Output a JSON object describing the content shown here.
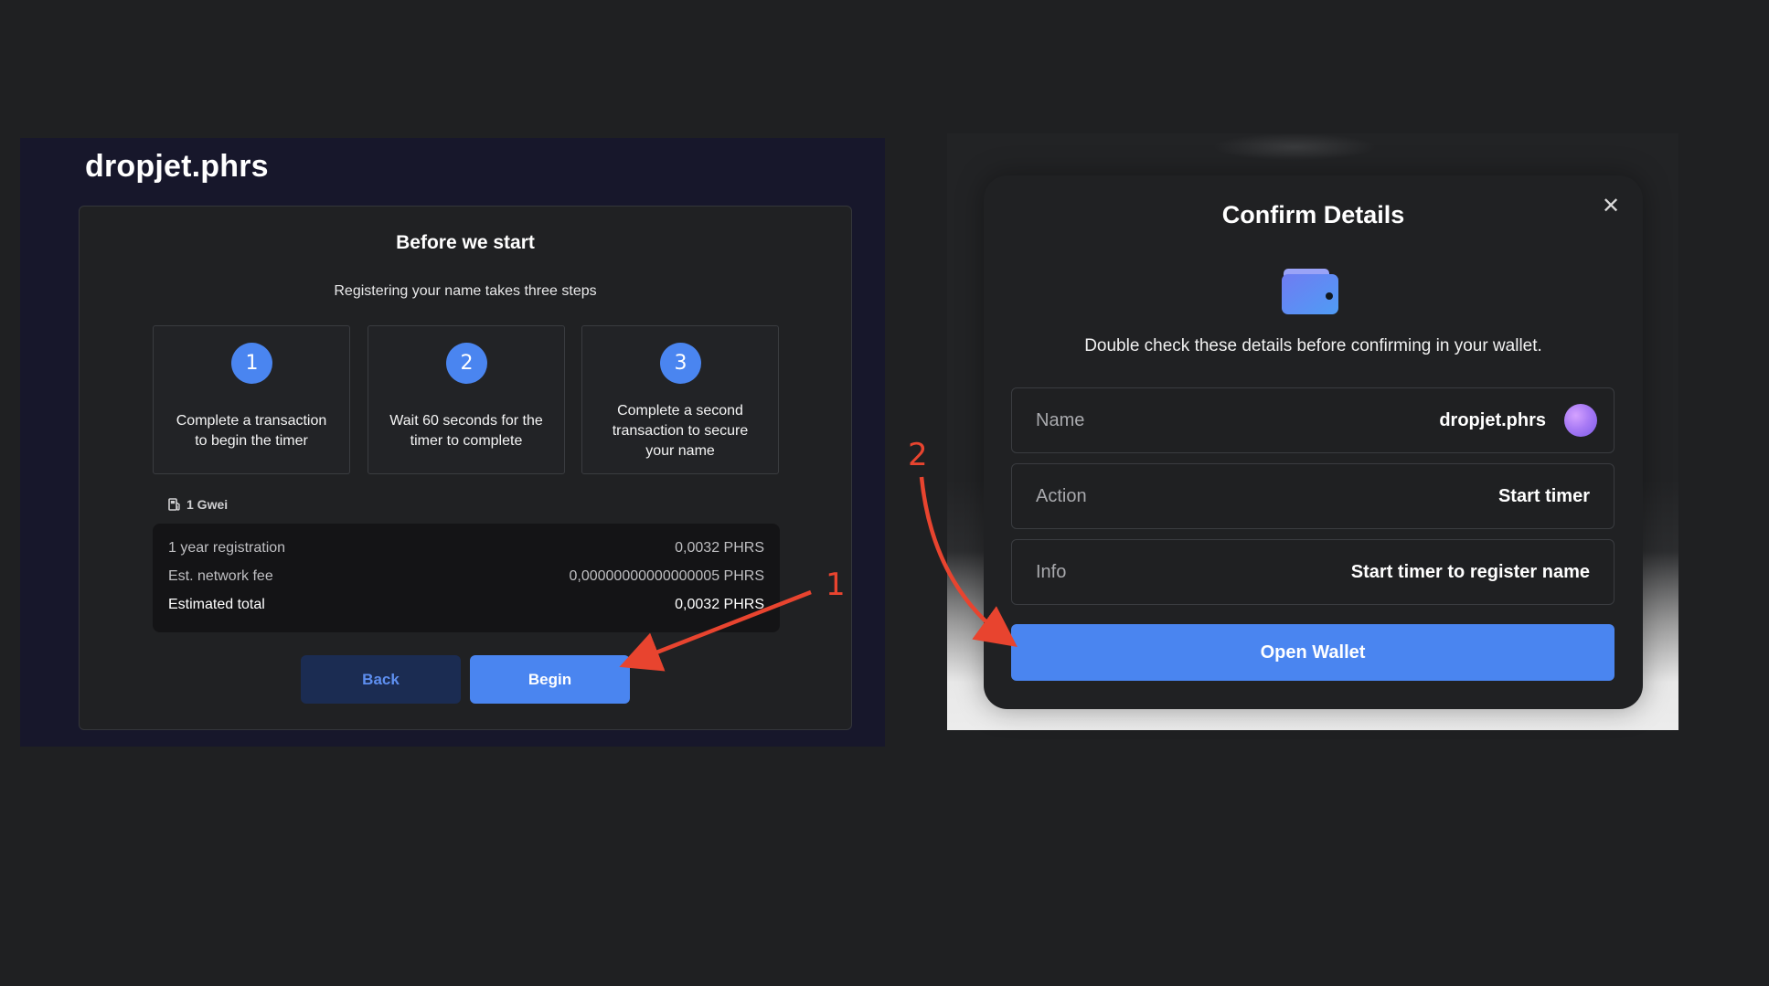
{
  "left": {
    "site_title": "dropjet.phrs",
    "heading": "Before we start",
    "subheading": "Registering your name takes three steps",
    "steps": [
      {
        "number": "1",
        "text": "Complete a transaction to begin the timer"
      },
      {
        "number": "2",
        "text": "Wait 60 seconds for the timer to complete"
      },
      {
        "number": "3",
        "text": "Complete a second transaction to secure your name"
      }
    ],
    "gas": {
      "icon": "gas-pump-icon",
      "label": "1 Gwei"
    },
    "fees": [
      {
        "label": "1 year registration",
        "value": "0,0032 PHRS"
      },
      {
        "label": "Est. network fee",
        "value": "0,00000000000000005 PHRS"
      },
      {
        "label": "Estimated total",
        "value": "0,0032 PHRS"
      }
    ],
    "back_label": "Back",
    "begin_label": "Begin"
  },
  "right": {
    "title": "Confirm Details",
    "close_icon": "close-icon",
    "wallet_icon": "wallet-icon",
    "description": "Double check these details before confirming in your wallet.",
    "rows": [
      {
        "label": "Name",
        "value": "dropjet.phrs"
      },
      {
        "label": "Action",
        "value": "Start timer"
      },
      {
        "label": "Info",
        "value": "Start timer to register name"
      }
    ],
    "open_wallet_label": "Open Wallet"
  },
  "annotations": {
    "step1": "1",
    "step2": "2",
    "color": "#e8442f"
  },
  "colors": {
    "accent": "#4a85f0",
    "background": "#1f2022",
    "card": "#202123",
    "left_panel_bg": "#17172b"
  }
}
